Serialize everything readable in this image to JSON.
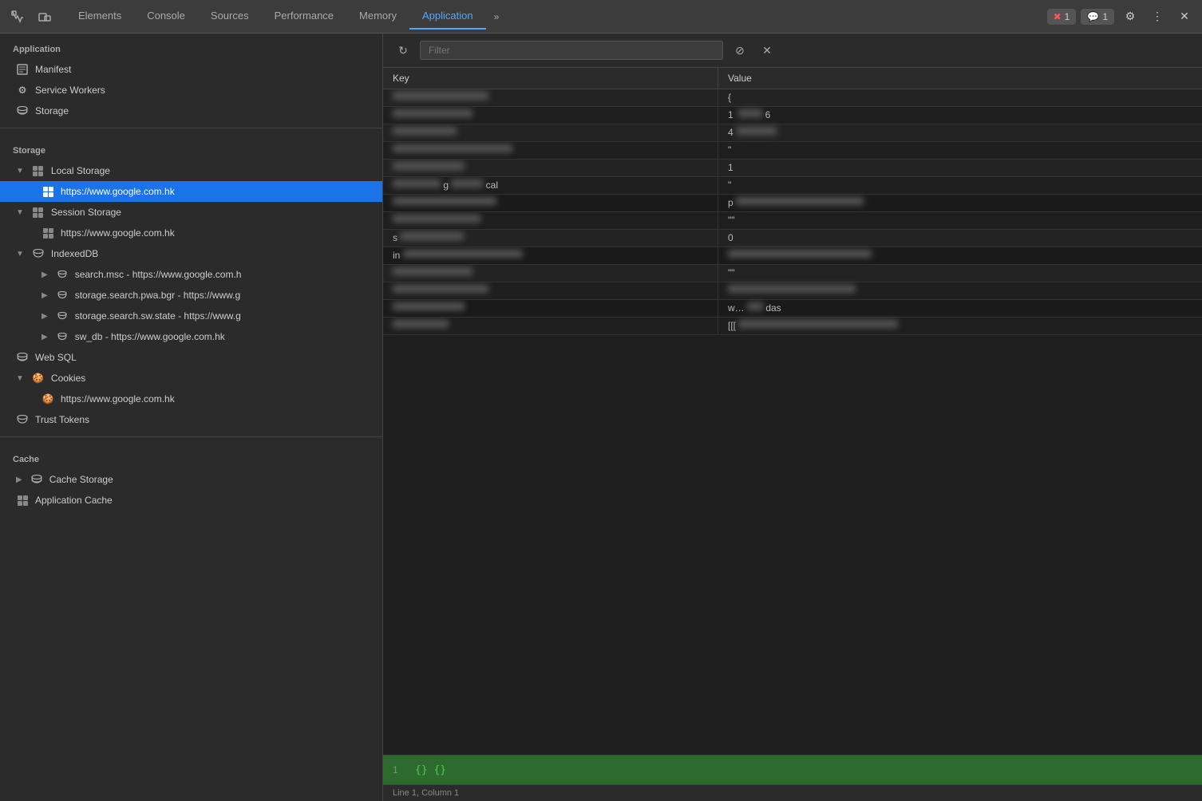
{
  "tabBar": {
    "tabs": [
      {
        "label": "Elements",
        "active": false
      },
      {
        "label": "Console",
        "active": false
      },
      {
        "label": "Sources",
        "active": false
      },
      {
        "label": "Performance",
        "active": false
      },
      {
        "label": "Memory",
        "active": false
      },
      {
        "label": "Application",
        "active": true
      }
    ],
    "moreLabel": "»",
    "errorBadge": "1",
    "messageBadge": "1"
  },
  "sidebar": {
    "applicationTitle": "Application",
    "applicationItems": [
      {
        "label": "Manifest",
        "icon": "manifest-icon",
        "level": 1
      },
      {
        "label": "Service Workers",
        "icon": "gear-icon",
        "level": 1
      },
      {
        "label": "Storage",
        "icon": "cylinder-icon",
        "level": 1
      }
    ],
    "storageTitle": "Storage",
    "storageItems": [
      {
        "label": "Local Storage",
        "icon": "grid-icon",
        "level": 1,
        "expandable": true,
        "expanded": true
      },
      {
        "label": "https://www.google.com.hk",
        "icon": "grid-icon",
        "level": 2,
        "active": true
      },
      {
        "label": "Session Storage",
        "icon": "grid-icon",
        "level": 1,
        "expandable": true,
        "expanded": true
      },
      {
        "label": "https://www.google.com.hk",
        "icon": "grid-icon",
        "level": 2
      },
      {
        "label": "IndexedDB",
        "icon": "cylinder-icon",
        "level": 1,
        "expandable": true,
        "expanded": true
      },
      {
        "label": "search.msc - https://www.google.com.h",
        "icon": "cylinder-icon",
        "level": 2,
        "expandable": true
      },
      {
        "label": "storage.search.pwa.bgr - https://www.g",
        "icon": "cylinder-icon",
        "level": 2,
        "expandable": true
      },
      {
        "label": "storage.search.sw.state - https://www.g",
        "icon": "cylinder-icon",
        "level": 2,
        "expandable": true
      },
      {
        "label": "sw_db - https://www.google.com.hk",
        "icon": "cylinder-icon",
        "level": 2,
        "expandable": true
      },
      {
        "label": "Web SQL",
        "icon": "cylinder-icon",
        "level": 1
      },
      {
        "label": "Cookies",
        "icon": "cookie-icon",
        "level": 1,
        "expandable": true,
        "expanded": true
      },
      {
        "label": "https://www.google.com.hk",
        "icon": "cookie-icon",
        "level": 2
      },
      {
        "label": "Trust Tokens",
        "icon": "cylinder-icon",
        "level": 1
      }
    ],
    "cacheTitle": "Cache",
    "cacheItems": [
      {
        "label": "Cache Storage",
        "icon": "cylinder-icon",
        "level": 1,
        "expandable": true
      },
      {
        "label": "Application Cache",
        "icon": "grid-icon",
        "level": 1
      }
    ]
  },
  "panel": {
    "filterPlaceholder": "Filter",
    "columns": {
      "key": "Key",
      "value": "Value"
    },
    "rows": [
      {
        "key": "",
        "value": "{",
        "blurKey": true,
        "blurValue": false
      },
      {
        "key": "",
        "value": "1",
        "blurKey": true,
        "blurValue": false,
        "valueExtra": "6"
      },
      {
        "key": "",
        "value": "4",
        "blurKey": true,
        "blurValue": false
      },
      {
        "key": "",
        "value": "\"",
        "blurKey": true,
        "blurValue": false
      },
      {
        "key": "",
        "value": "1",
        "blurKey": true,
        "blurValue": false
      },
      {
        "key": "g",
        "value": "\"",
        "blurKey": true,
        "keyExtra": "cal",
        "blurValue": false
      },
      {
        "key": "",
        "value": "p",
        "blurKey": true,
        "blurValue": true
      },
      {
        "key": "",
        "value": "\"\"",
        "blurKey": true,
        "blurValue": false
      },
      {
        "key": "s",
        "value": "0",
        "blurKey": true,
        "blurValue": false
      },
      {
        "key": "in",
        "value": "",
        "blurKey": false,
        "blurValue": true
      },
      {
        "key": "",
        "value": "\"\"",
        "blurKey": true,
        "blurValue": false
      },
      {
        "key": "",
        "value": "",
        "blurKey": true,
        "blurValue": true
      },
      {
        "key": "",
        "value": "w…was",
        "blurKey": true,
        "blurValue": false,
        "valueExtra": "das"
      },
      {
        "key": "",
        "value": "[[[",
        "blurKey": true,
        "blurValue": true
      }
    ],
    "preview": {
      "lineNum": "1",
      "content": "{} {}"
    },
    "statusBar": "Line 1, Column 1"
  },
  "icons": {
    "refresh": "↻",
    "block": "⊘",
    "close": "✕",
    "chevronDown": "▼",
    "chevronRight": "▶",
    "more": "⋮",
    "settings": "⚙",
    "error": "✖",
    "message": "💬"
  }
}
